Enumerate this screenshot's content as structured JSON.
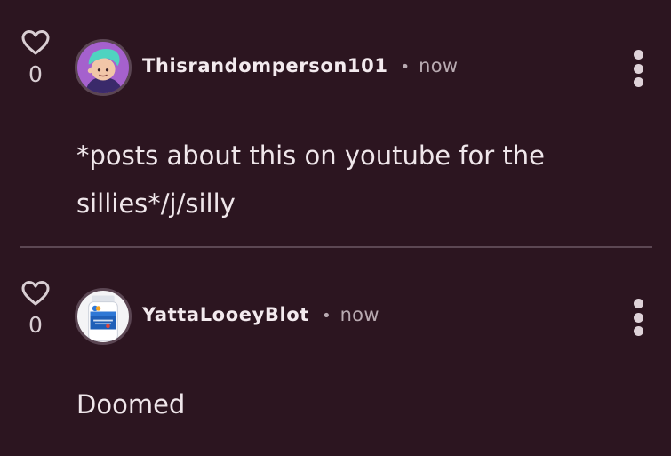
{
  "comments": [
    {
      "likes": "0",
      "username": "Thisrandomperson101",
      "separator": "•",
      "time": "now",
      "text": "*posts about this on youtube for the sillies*/j/silly",
      "avatar": "cartoon-character-avatar"
    },
    {
      "likes": "0",
      "username": "YattaLooeyBlot",
      "separator": "•",
      "time": "now",
      "text": "Doomed",
      "avatar": "medicine-bottle-avatar"
    }
  ],
  "colors": {
    "background": "#2c1520",
    "text": "#efe6ea",
    "muted": "#b8aab1",
    "divider": "#5c4753"
  },
  "icons": {
    "like": "heart-icon",
    "more": "more-options-icon"
  }
}
